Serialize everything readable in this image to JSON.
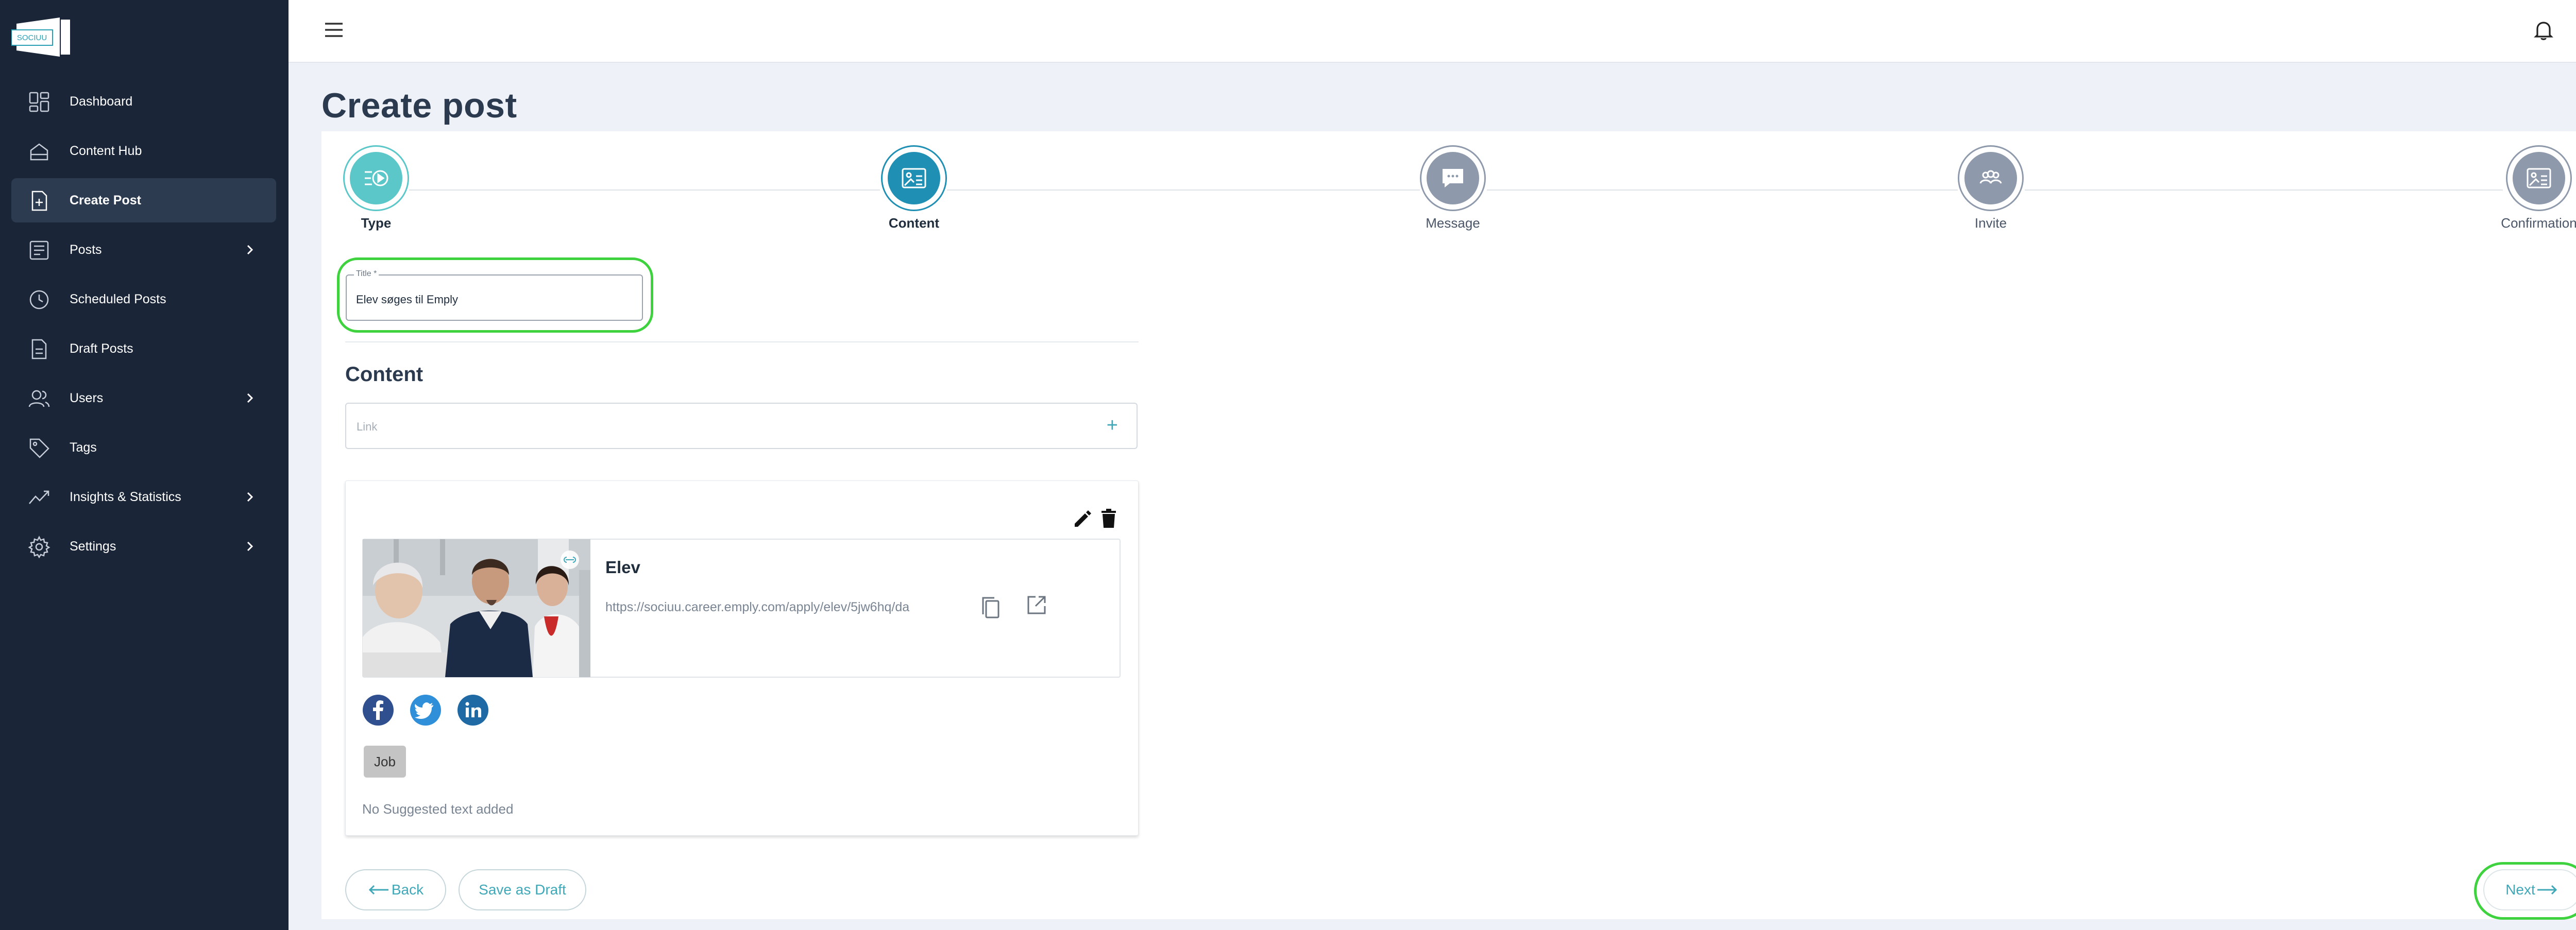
{
  "app": {
    "logo_text": "SOCIUU"
  },
  "sidebar": {
    "items": [
      {
        "label": "Dashboard",
        "icon": "dashboard-icon",
        "has_chevron": false
      },
      {
        "label": "Content Hub",
        "icon": "content-hub-icon",
        "has_chevron": false
      },
      {
        "label": "Create Post",
        "icon": "create-post-icon",
        "has_chevron": false,
        "active": true
      },
      {
        "label": "Posts",
        "icon": "posts-icon",
        "has_chevron": true
      },
      {
        "label": "Scheduled Posts",
        "icon": "clock-icon",
        "has_chevron": false
      },
      {
        "label": "Draft Posts",
        "icon": "document-icon",
        "has_chevron": false
      },
      {
        "label": "Users",
        "icon": "users-icon",
        "has_chevron": true
      },
      {
        "label": "Tags",
        "icon": "tag-icon",
        "has_chevron": false
      },
      {
        "label": "Insights & Statistics",
        "icon": "chart-line-icon",
        "has_chevron": true
      },
      {
        "label": "Settings",
        "icon": "gear-icon",
        "has_chevron": true
      }
    ]
  },
  "page": {
    "title": "Create post"
  },
  "stepper": {
    "steps": [
      {
        "label": "Type",
        "state": "completed"
      },
      {
        "label": "Content",
        "state": "active"
      },
      {
        "label": "Message",
        "state": "pending"
      },
      {
        "label": "Invite",
        "state": "pending"
      },
      {
        "label": "Confirmation",
        "state": "pending"
      }
    ]
  },
  "form": {
    "title_label": "Title *",
    "title_value": "Elev søges til Emply",
    "content_heading": "Content",
    "link_placeholder": "Link",
    "link_add": "+"
  },
  "post": {
    "title": "Elev",
    "url": "https://sociuu.career.emply.com/apply/elev/5jw6hq/da",
    "tag": "Job",
    "suggested_text": "No Suggested text added",
    "networks": [
      "facebook",
      "twitter",
      "linkedin"
    ]
  },
  "actions": {
    "back": "Back",
    "save_draft": "Save as Draft",
    "next": "Next"
  },
  "colors": {
    "sidebar_bg": "#1a2638",
    "accent": "#3fa8b8",
    "active_step": "#1f8fb3",
    "done_step": "#5bc7c9",
    "highlight": "#3ed33e"
  }
}
